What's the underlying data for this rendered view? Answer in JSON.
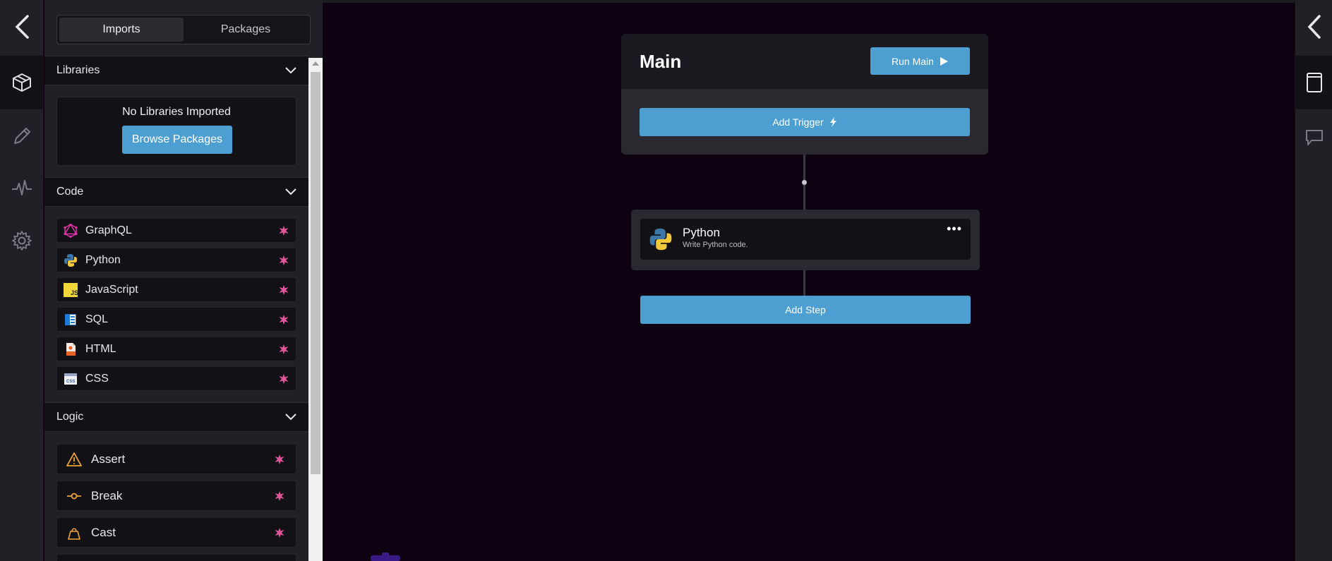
{
  "tabs": [
    {
      "label": "Imports",
      "active": true
    },
    {
      "label": "Packages",
      "active": false
    }
  ],
  "sections": {
    "libraries": {
      "title": "Libraries",
      "empty_text": "No Libraries Imported",
      "browse_label": "Browse Packages"
    },
    "code": {
      "title": "Code"
    },
    "logic": {
      "title": "Logic"
    }
  },
  "code_items": [
    {
      "label": "GraphQL",
      "icon": "graphql-icon"
    },
    {
      "label": "Python",
      "icon": "python-icon"
    },
    {
      "label": "JavaScript",
      "icon": "javascript-icon"
    },
    {
      "label": "SQL",
      "icon": "sql-icon"
    },
    {
      "label": "HTML",
      "icon": "html-icon"
    },
    {
      "label": "CSS",
      "icon": "css-icon"
    }
  ],
  "logic_items": [
    {
      "label": "Assert",
      "icon": "warning-triangle-icon"
    },
    {
      "label": "Break",
      "icon": "break-icon"
    },
    {
      "label": "Cast",
      "icon": "cast-icon"
    }
  ],
  "flow": {
    "main_title": "Main",
    "run_label": "Run Main",
    "trigger_label": "Add Trigger",
    "step": {
      "title": "Python",
      "subtitle": "Write Python code.",
      "menu": "•••"
    },
    "add_step_label": "Add Step"
  },
  "colors": {
    "accent": "#4d9fd2",
    "canvas_bg": "#0d0112",
    "panel_bg": "#212026",
    "star": "#e0559a"
  }
}
